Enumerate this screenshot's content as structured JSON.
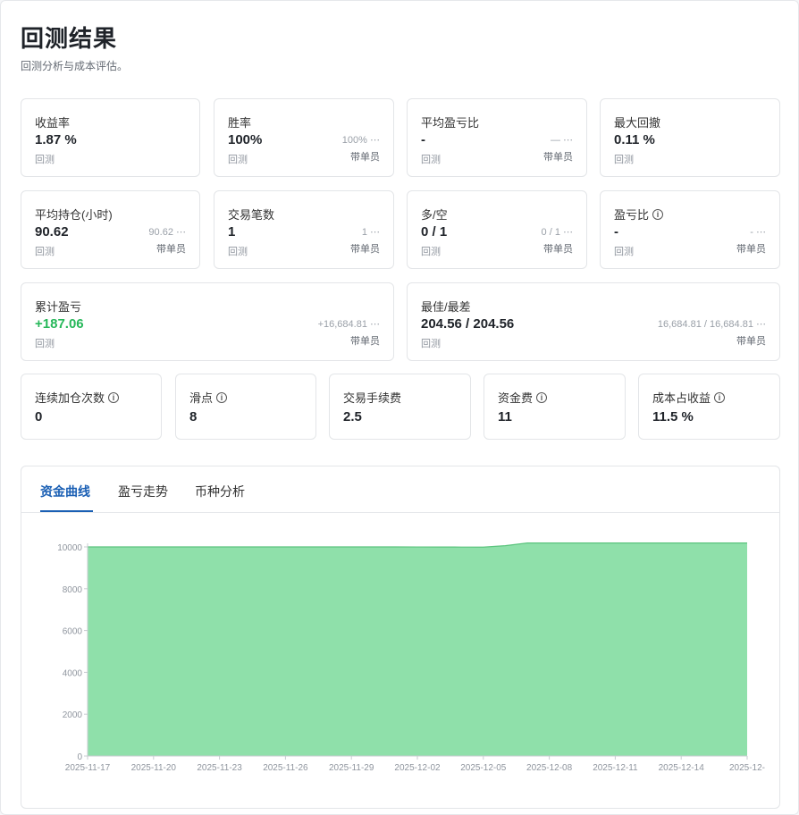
{
  "header": {
    "title": "回测结果",
    "subtitle": "回测分析与成本评估。"
  },
  "metrics_row1": [
    {
      "label": "收益率",
      "value": "1.87 %",
      "source": "回测",
      "compare": "",
      "compare_source": ""
    },
    {
      "label": "胜率",
      "value": "100%",
      "source": "回测",
      "compare": "100% ⋯",
      "compare_source": "带单员"
    },
    {
      "label": "平均盈亏比",
      "value": "-",
      "source": "回测",
      "compare": "— ⋯",
      "compare_source": "带单员"
    },
    {
      "label": "最大回撤",
      "value": "0.11 %",
      "source": "回测",
      "compare": "",
      "compare_source": ""
    }
  ],
  "metrics_row2": [
    {
      "label": "平均持仓(小时)",
      "value": "90.62",
      "source": "回测",
      "compare": "90.62 ⋯",
      "compare_source": "带单员"
    },
    {
      "label": "交易笔数",
      "value": "1",
      "source": "回测",
      "compare": "1 ⋯",
      "compare_source": "带单员"
    },
    {
      "label": "多/空",
      "value": "0 / 1",
      "source": "回测",
      "compare": "0 / 1 ⋯",
      "compare_source": "带单员"
    },
    {
      "label": "盈亏比",
      "value": "-",
      "source": "回测",
      "compare": "- ⋯",
      "compare_source": "带单员"
    }
  ],
  "metrics_row3": [
    {
      "label": "累计盈亏",
      "value": "+187.06",
      "source": "回测",
      "compare": "+16,684.81 ⋯",
      "compare_source": "带单员"
    },
    {
      "label": "最佳/最差",
      "value": "204.56 / 204.56",
      "source": "回测",
      "compare": "16,684.81 / 16,684.81 ⋯",
      "compare_source": "带单员"
    }
  ],
  "cost_metrics": [
    {
      "label": "连续加仓次数",
      "value": "0"
    },
    {
      "label": "滑点",
      "value": "8"
    },
    {
      "label": "交易手续费",
      "value": "2.5"
    },
    {
      "label": "资金费",
      "value": "11"
    },
    {
      "label": "成本占收益",
      "value": "11.5 %"
    }
  ],
  "info_icon_glyph": "i",
  "tabs": [
    {
      "label": "资金曲线"
    },
    {
      "label": "盈亏走势"
    },
    {
      "label": "币种分析"
    }
  ],
  "colors": {
    "accent": "#1a5fb4",
    "positive": "#27b85a",
    "area_fill": "#8fe0aa",
    "area_line": "#5cc47e"
  },
  "chart_data": {
    "type": "area",
    "x": [
      "2025-11-17",
      "2025-11-18",
      "2025-11-19",
      "2025-11-20",
      "2025-11-21",
      "2025-11-22",
      "2025-11-23",
      "2025-11-24",
      "2025-11-25",
      "2025-11-26",
      "2025-11-27",
      "2025-11-28",
      "2025-11-29",
      "2025-11-30",
      "2025-12-01",
      "2025-12-02",
      "2025-12-03",
      "2025-12-04",
      "2025-12-05",
      "2025-12-06",
      "2025-12-07",
      "2025-12-08",
      "2025-12-09",
      "2025-12-10",
      "2025-12-11",
      "2025-12-12",
      "2025-12-13",
      "2025-12-14",
      "2025-12-15",
      "2025-12-16",
      "2025-12-17"
    ],
    "y": [
      10000,
      10000,
      10000,
      10000,
      10000,
      10000,
      10000,
      10000,
      10000,
      10000,
      10000,
      10000,
      10000,
      10000,
      10000,
      9998,
      9996,
      9993,
      9990,
      10060,
      10187,
      10187,
      10187,
      10187,
      10187,
      10187,
      10187,
      10187,
      10187,
      10187,
      10187
    ],
    "ylim": [
      0,
      10000
    ],
    "yticks": [
      "10000",
      "8000",
      "6000",
      "4000",
      "2000",
      "0"
    ],
    "xticks": [
      "2025-11-17",
      "2025-11-20",
      "2025-11-23",
      "2025-11-26",
      "2025-11-29",
      "2025-12-02",
      "2025-12-05",
      "2025-12-08",
      "2025-12-11",
      "2025-12-14",
      "2025-12-"
    ],
    "xlabel": "",
    "ylabel": "",
    "title": "",
    "grid": false,
    "legend": "none"
  }
}
